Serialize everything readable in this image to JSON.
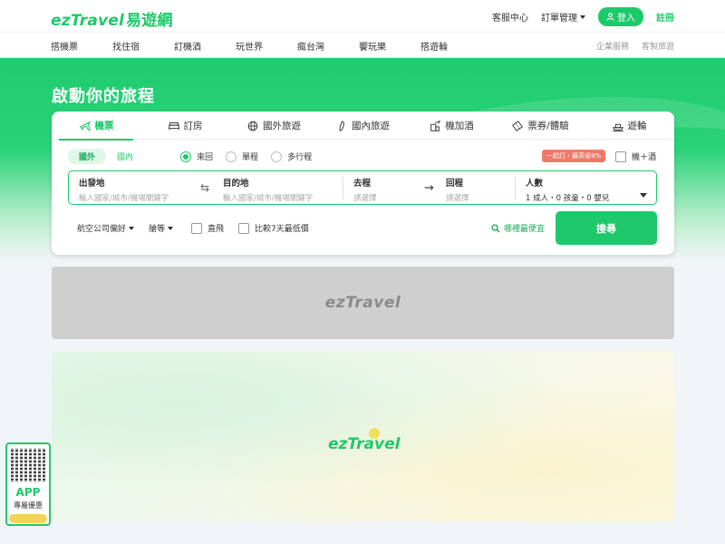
{
  "header": {
    "logo": "ezTravel",
    "logo_sub": "易遊網",
    "links": [
      "客服中心",
      "訂單管理"
    ],
    "login": "登入",
    "register": "註冊"
  },
  "nav": {
    "items": [
      "搭機票",
      "找住宿",
      "訂機酒",
      "玩世界",
      "瘋台灣",
      "饗玩樂",
      "搭遊輪"
    ],
    "right": [
      "企業服務",
      "客製旅遊"
    ]
  },
  "hero": {
    "title": "啟動你的旅程"
  },
  "search": {
    "tabs": [
      {
        "label": "機票",
        "icon": "plane-icon"
      },
      {
        "label": "訂房",
        "icon": "bed-icon"
      },
      {
        "label": "國外旅遊",
        "icon": "globe-icon"
      },
      {
        "label": "國內旅遊",
        "icon": "taiwan-icon"
      },
      {
        "label": "機加酒",
        "icon": "hotel-plane-icon"
      },
      {
        "label": "票券/體驗",
        "icon": "ticket-icon"
      },
      {
        "label": "遊輪",
        "icon": "ship-icon"
      }
    ],
    "scope": [
      "國外",
      "國內"
    ],
    "trip_types": [
      "來回",
      "單程",
      "多行程"
    ],
    "promo": "一起訂・最高省8%",
    "flight_hotel": "機＋酒",
    "origin": {
      "label": "出發地",
      "placeholder": "輸入國家/城市/機場關鍵字"
    },
    "destination": {
      "label": "目的地",
      "placeholder": "輸入國家/城市/機場關鍵字"
    },
    "depart": {
      "label": "去程",
      "placeholder": "請選擇"
    },
    "return": {
      "label": "回程",
      "placeholder": "請選擇"
    },
    "pax": {
      "label": "人數",
      "value": "1 成人・0 孩童・0 嬰兒"
    },
    "filters": [
      "航空公司偏好",
      "艙等",
      "直飛",
      "比較7天最低價"
    ],
    "cheapest": "哪裡最便宜",
    "button": "搜尋"
  },
  "banners": {
    "logo": "ezTravel"
  },
  "app_badge": {
    "title": "APP",
    "subtitle": "專屬優惠"
  },
  "colors": {
    "brand": "#1ec96b",
    "promo": "#f07a6a"
  }
}
